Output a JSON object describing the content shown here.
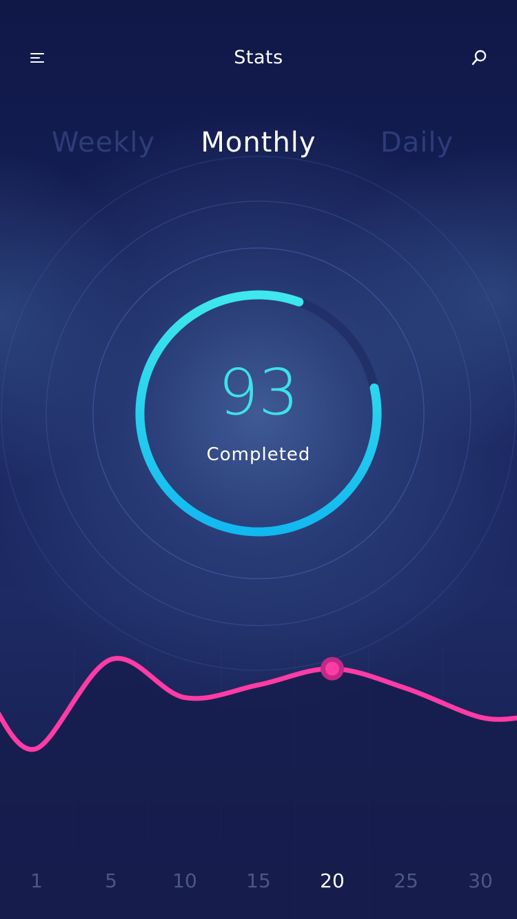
{
  "header": {
    "title": "Stats"
  },
  "tabs": [
    {
      "label": "Weekly",
      "active": false
    },
    {
      "label": "Monthly",
      "active": true
    },
    {
      "label": "Daily",
      "active": false
    }
  ],
  "progress": {
    "value": "93",
    "label": "Completed",
    "fraction": 0.84
  },
  "chart_data": {
    "type": "line",
    "x": [
      0,
      1,
      5,
      10,
      15,
      20,
      25,
      30,
      31
    ],
    "values": [
      0.45,
      0.08,
      0.85,
      0.52,
      0.63,
      0.77,
      0.6,
      0.35,
      0.35
    ],
    "x_labels": [
      "1",
      "5",
      "10",
      "15",
      "20",
      "25",
      "30"
    ],
    "selected_label": "20",
    "line_color": "#ff3ba6",
    "marker_color": "#ff3ba6"
  },
  "colors": {
    "background": "#141b4a",
    "progress_start": "#3ee8ec",
    "progress_end": "#12b8f0",
    "track": "#22306a",
    "ring": "#4a63b0",
    "accent_pink": "#ff3ba6"
  },
  "icons": {
    "menu": "menu-icon",
    "search": "search-icon"
  }
}
